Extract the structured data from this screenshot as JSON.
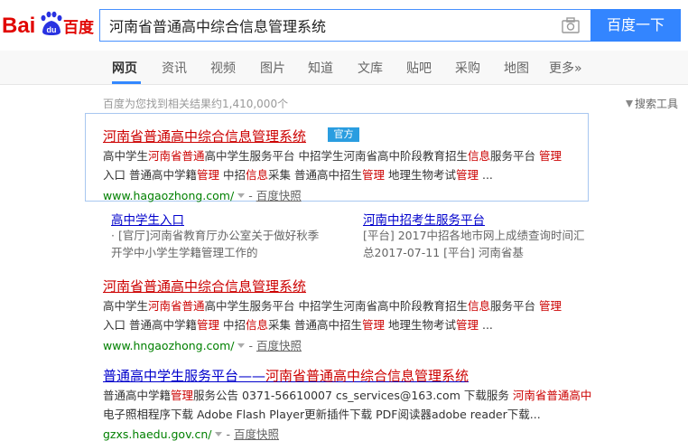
{
  "logo": {
    "text_bai": "Bai",
    "text_du": "du",
    "text_cn": "百度"
  },
  "search": {
    "query": "河南省普通高中综合信息管理系统",
    "button_label": "百度一下"
  },
  "nav": {
    "items": [
      "网页",
      "资讯",
      "视频",
      "图片",
      "知道",
      "文库",
      "贴吧",
      "采购",
      "地图",
      "更多»"
    ],
    "active": "网页"
  },
  "stats_text": "百度为您找到相关结果约1,410,000个",
  "tools_label": "搜索工具",
  "results": [
    {
      "title": "河南省普通高中综合信息管理系统",
      "badge": "官方",
      "abstract_line1": [
        "高中学生",
        "河南省普通",
        "高中学生服务平台 中招学生河南省高中阶段教育招生",
        "信息",
        "服务平台 ",
        "管理"
      ],
      "abstract_line2": [
        "入口 普通高中学籍",
        "管理",
        " 中招",
        "信息",
        "采集 普通高中招生",
        "管理",
        " 地理生物考试",
        "管理",
        " ..."
      ],
      "url": "www.hagaozhong.com/",
      "dash": "-",
      "cache": "百度快照"
    },
    {
      "title": "河南省普通高中综合信息管理系统",
      "abstract_line1": [
        "高中学生",
        "河南省普通",
        "高中学生服务平台 中招学生河南省高中阶段教育招生",
        "信息",
        "服务平台 ",
        "管理"
      ],
      "abstract_line2": [
        "入口 普通高中学籍",
        "管理",
        " 中招",
        "信息",
        "采集 普通高中招生",
        "管理",
        " 地理生物考试",
        "管理",
        " ..."
      ],
      "url": "www.hngaozhong.com/",
      "dash": "-",
      "cache": "百度快照"
    },
    {
      "title_part1": "普通高中学生服务平台——",
      "title_part2": "河南省普通高中综合信息管理系统",
      "abstract_line1": [
        "普通高中学籍",
        "管理",
        "服务公告 0371-56610007 cs_services@163.com 下载服务 ",
        "河南省普通高中"
      ],
      "abstract_line2": "电子照相程序下载 Adobe Flash Player更新插件下载 PDF阅读器adobe reader下载...",
      "url": "gzxs.haedu.gov.cn/",
      "dash": "-",
      "cache": "百度快照"
    }
  ],
  "sublinks": [
    {
      "title": "高中学生入口",
      "desc1": "· [官厅]河南省教育厅办公室关于做好秋季",
      "desc2": "开学中小学生学籍管理工作的"
    },
    {
      "title": "河南中招考生服务平台",
      "desc1": "[平台] 2017中招各地市网上成绩查询时间汇",
      "desc2": "总2017-07-11 [平台] 河南省基"
    }
  ]
}
